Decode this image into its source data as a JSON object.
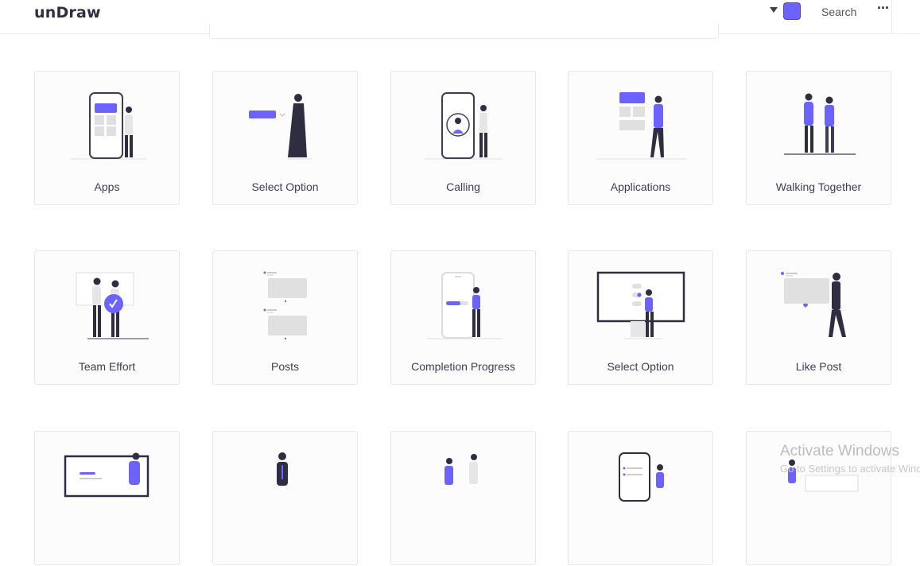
{
  "header": {
    "logo": "unDraw",
    "search_label": "Search",
    "more_label": "···",
    "color_selector": {
      "value": "#6c63ff"
    }
  },
  "colors": {
    "accent": "#6c63ff",
    "dark": "#2f2e41",
    "gray": "#e0e0e0"
  },
  "illustrations": [
    {
      "title": "Apps"
    },
    {
      "title": "Select Option"
    },
    {
      "title": "Calling"
    },
    {
      "title": "Applications"
    },
    {
      "title": "Walking Together"
    },
    {
      "title": "Team Effort"
    },
    {
      "title": "Posts"
    },
    {
      "title": "Completion Progress"
    },
    {
      "title": "Select Option"
    },
    {
      "title": "Like Post"
    },
    {
      "title": ""
    },
    {
      "title": ""
    },
    {
      "title": ""
    },
    {
      "title": ""
    },
    {
      "title": ""
    }
  ],
  "watermark": {
    "title": "Activate Windows",
    "subtitle": "Go to Settings to activate Windows."
  }
}
